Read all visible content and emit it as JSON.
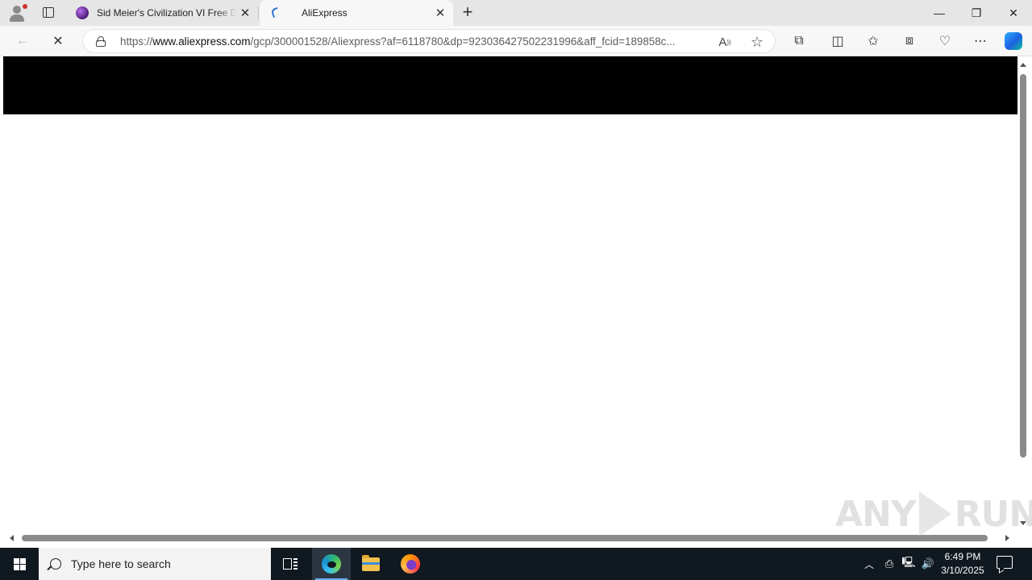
{
  "browser": {
    "tabs": [
      {
        "title": "Sid Meier's Civilization VI Free Download",
        "favicon": "civilization-globe-icon",
        "active": false
      },
      {
        "title": "AliExpress",
        "favicon": "aliexpress-loading-icon",
        "active": true
      }
    ],
    "new_tab_symbol": "+",
    "window_controls": {
      "minimize": "—",
      "restore": "❐",
      "close": "✕"
    },
    "address_bar": {
      "scheme": "https://",
      "host": "www.aliexpress.com",
      "path": "/gcp/300001528/Aliexpress?af=6118780&dp=9230364275022319​96&aff_fcid=189858c..."
    },
    "nav": {
      "back": "←",
      "stop": "✕"
    },
    "toolbar_icons": [
      "read-aloud-icon",
      "favorite-star-icon",
      "extensions-icon",
      "split-screen-icon",
      "favorites-icon",
      "collections-icon",
      "browser-essentials-icon",
      "more-menu-icon",
      "copilot-icon"
    ]
  },
  "page": {
    "loading": true,
    "header_color": "#000000"
  },
  "watermark": {
    "left": "ANY",
    "right": "RUN"
  },
  "taskbar": {
    "search_placeholder": "Type here to search",
    "apps": [
      "task-view-icon",
      "edge-icon",
      "file-explorer-icon",
      "firefox-icon"
    ],
    "clock": {
      "time": "6:49 PM",
      "date": "3/10/2025"
    },
    "tray_icons": [
      "show-hidden-icons-chevron",
      "meet-now-icon",
      "network-icon",
      "volume-icon"
    ],
    "accent": "#6fb3f2"
  }
}
